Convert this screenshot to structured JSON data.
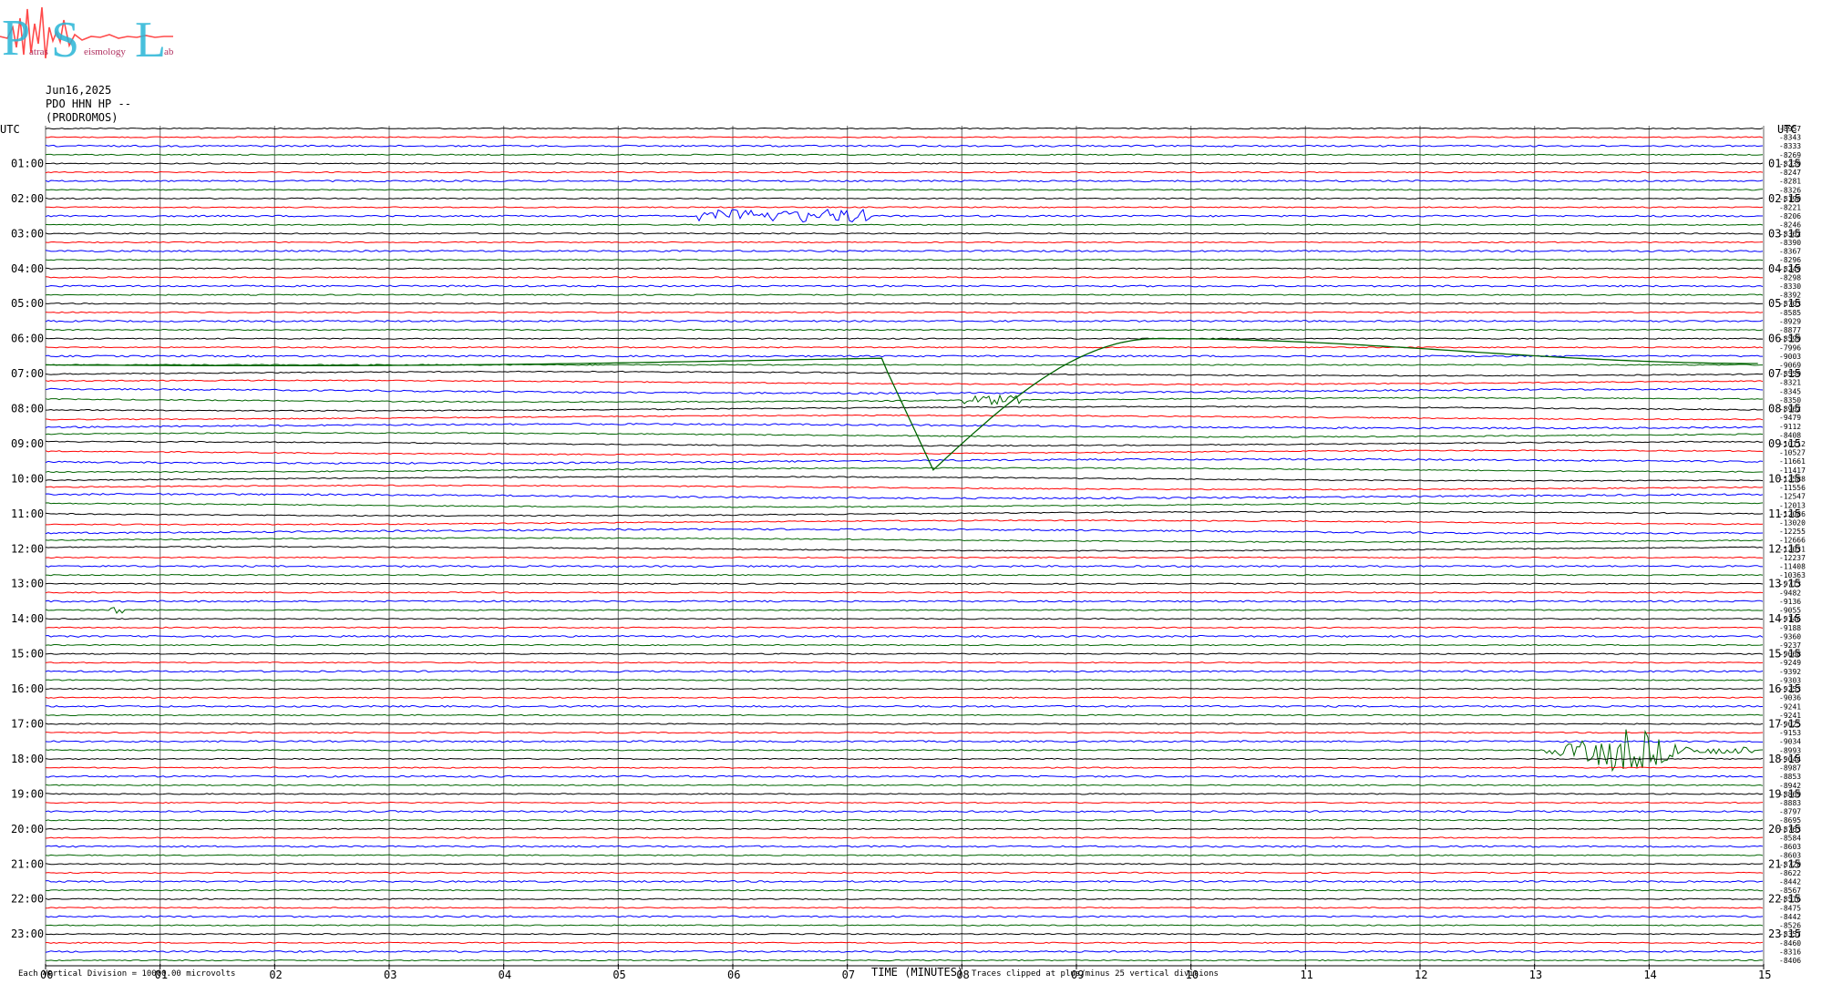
{
  "logo": {
    "letters": [
      "P",
      "S",
      "L"
    ],
    "words": [
      "atras",
      "eismology",
      "ab"
    ],
    "colors": {
      "letters": "#29b6d6",
      "wave": "#ff4b4b"
    }
  },
  "header": {
    "date": "Jun16,2025",
    "station": "PDO HHN HP --",
    "site": "(PRODROMOS)"
  },
  "colors": {
    "trace_cycle": [
      "#000000",
      "#ff0000",
      "#0000ff",
      "#006400"
    ],
    "grid": "#808080"
  },
  "chart_data": {
    "type": "line",
    "xlabel": "TIME (MINUTES)",
    "x_ticks": [
      "00",
      "01",
      "02",
      "03",
      "04",
      "05",
      "06",
      "07",
      "08",
      "09",
      "10",
      "11",
      "12",
      "13",
      "14",
      "15"
    ],
    "xlim": [
      0,
      15
    ],
    "left_axis_title": "UTC",
    "right_axis_title": "UTC",
    "left_hour_labels": [
      "01:00",
      "02:00",
      "03:00",
      "04:00",
      "05:00",
      "06:00",
      "07:00",
      "08:00",
      "09:00",
      "10:00",
      "11:00",
      "12:00",
      "13:00",
      "14:00",
      "15:00",
      "16:00",
      "17:00",
      "18:00",
      "19:00",
      "20:00",
      "21:00",
      "22:00",
      "23:00"
    ],
    "right_hour_labels": [
      "01:15",
      "02:15",
      "03:15",
      "04:15",
      "05:15",
      "06:15",
      "07:15",
      "08:15",
      "09:15",
      "10:15",
      "11:15",
      "12:15",
      "13:15",
      "14:15",
      "15:15",
      "16:15",
      "17:15",
      "18:15",
      "19:15",
      "20:15",
      "21:15",
      "22:15",
      "23:15"
    ],
    "trace_offsets": [
      "-8957",
      "-8343",
      "-8333",
      "-8269",
      "-8239",
      "-8247",
      "-8281",
      "-8326",
      "-8190",
      "-8221",
      "-8206",
      "-8246",
      "-8362",
      "-8390",
      "-8367",
      "-8296",
      "-8249",
      "-8298",
      "-8330",
      "-8392",
      "-8703",
      "-8585",
      "-8929",
      "-8877",
      "-8599",
      "-7996",
      "-9003",
      "-9069",
      "-8559",
      "-8321",
      "-8345",
      "-8350",
      "-8962",
      "-9479",
      "-9112",
      "-8408",
      "-10112",
      "-10527",
      "-11661",
      "-11417",
      "-12588",
      "-11556",
      "-12547",
      "-12013",
      "-12086",
      "-13020",
      "-12255",
      "-12666",
      "-12031",
      "-12237",
      "-11408",
      "-10363",
      "-9713",
      "-9482",
      "-9136",
      "-9055",
      "-9146",
      "-9188",
      "-9360",
      "-9237",
      "-9068",
      "-9249",
      "-9392",
      "-9303",
      "-9253",
      "-9036",
      "-9241",
      "-9241",
      "-9025",
      "-9153",
      "-9034",
      "-8993",
      "-9044",
      "-8987",
      "-8853",
      "-8942",
      "-8869",
      "-8883",
      "-8797",
      "-8695",
      "-8763",
      "-8584",
      "-8603",
      "-8603",
      "-8720",
      "-8622",
      "-8442",
      "-8567",
      "-8516",
      "-8475",
      "-8442",
      "-8526",
      "-8357",
      "-8460",
      "-8316",
      "-8406"
    ],
    "footer_left": "Each Vertical Division = 10000.00 microvolts",
    "footer_right": "Traces clipped at plus/minus 25 vertical divisions"
  }
}
